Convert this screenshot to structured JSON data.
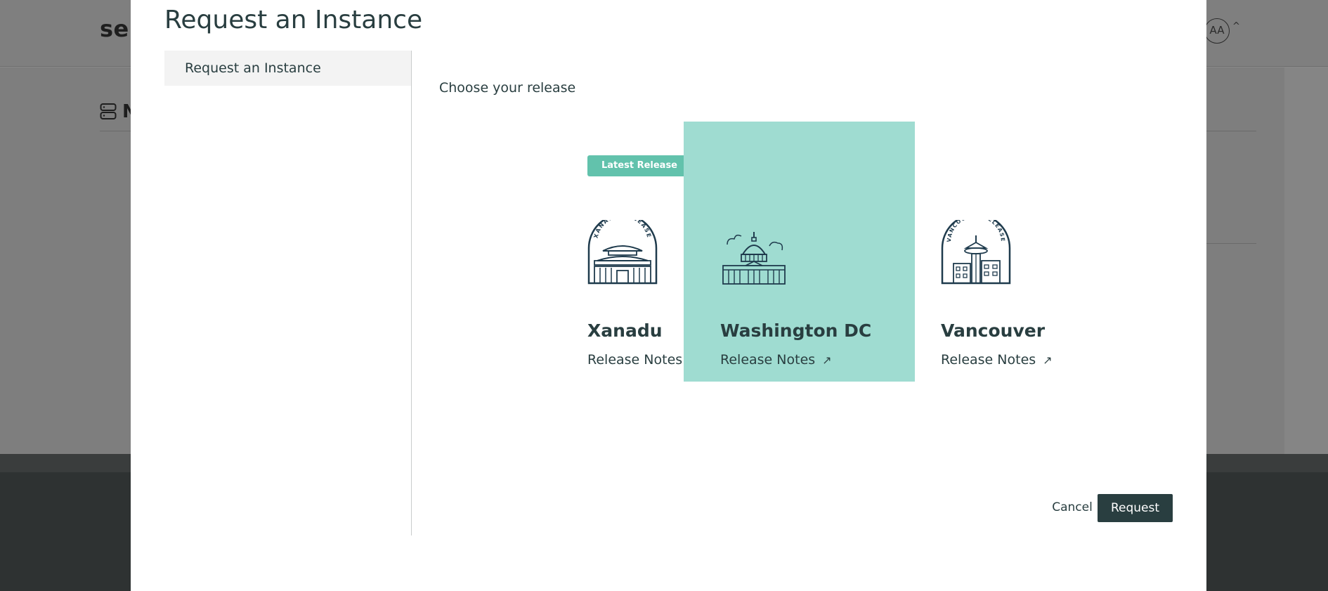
{
  "background": {
    "logo_text": "serv",
    "avatar_initials": "AA",
    "section_title_partial": "N"
  },
  "modal": {
    "title": "Request an Instance",
    "nav": {
      "items": [
        {
          "label": "Request an Instance",
          "active": true
        }
      ]
    },
    "section_label": "Choose your release",
    "releases": [
      {
        "name": "Xanadu",
        "badge": "Latest Release",
        "link_label": "Release Notes",
        "emblem_text": "XANADU RELEASE",
        "icon": "xanadu-emblem-icon",
        "selected": false
      },
      {
        "name": "Washington DC",
        "badge": "",
        "link_label": "Release Notes",
        "emblem_text": "",
        "icon": "washington-capitol-icon",
        "selected": true
      },
      {
        "name": "Vancouver",
        "badge": "",
        "link_label": "Release Notes",
        "emblem_text": "VANCOUVER RELEASE",
        "icon": "vancouver-emblem-icon",
        "selected": false
      }
    ],
    "actions": {
      "cancel_label": "Cancel",
      "request_label": "Request"
    }
  },
  "colors": {
    "primary_dark": "#293e40",
    "selected_card": "#9fdcd1",
    "badge": "#62c2ac",
    "nav_active_bg": "#f3f3f3"
  }
}
